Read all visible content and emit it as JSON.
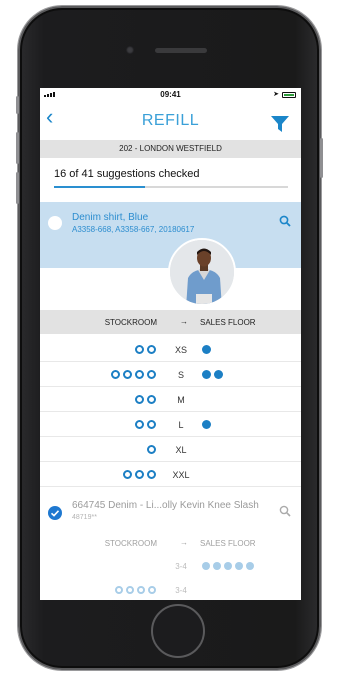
{
  "status_bar": {
    "time": "09:41"
  },
  "nav": {
    "back_icon": "chevron-left-icon",
    "title": "REFILL",
    "filter_icon": "filter-icon"
  },
  "store": "202 - LONDON WESTFIELD",
  "progress": {
    "text": "16 of 41 suggestions checked",
    "checked": 16,
    "total": 41
  },
  "selected_item": {
    "name": "Denim shirt, Blue",
    "codes": "A3358-668, A3358-667, 20180617"
  },
  "columns": {
    "left": "STOCKROOM",
    "arrow": "→",
    "right": "SALES FLOOR"
  },
  "sizes": [
    {
      "label": "XS",
      "stockroom": 2,
      "sales_floor": 1
    },
    {
      "label": "S",
      "stockroom": 4,
      "sales_floor": 2
    },
    {
      "label": "M",
      "stockroom": 2,
      "sales_floor": 0
    },
    {
      "label": "L",
      "stockroom": 2,
      "sales_floor": 1
    },
    {
      "label": "XL",
      "stockroom": 1,
      "sales_floor": 0
    },
    {
      "label": "XXL",
      "stockroom": 3,
      "sales_floor": 0
    }
  ],
  "second_item": {
    "name": "664745 Denim - Li...olly Kevin Knee Slash",
    "code": "48719**"
  },
  "faded_rows": [
    {
      "label": "3-4",
      "stockroom": 0,
      "sales_floor": 5
    },
    {
      "label": "3-4",
      "stockroom": 4,
      "sales_floor": 0
    }
  ],
  "colors": {
    "accent": "#1c7fc4",
    "selected_bg": "#c7def0",
    "header_bg": "#e2e2e2"
  }
}
